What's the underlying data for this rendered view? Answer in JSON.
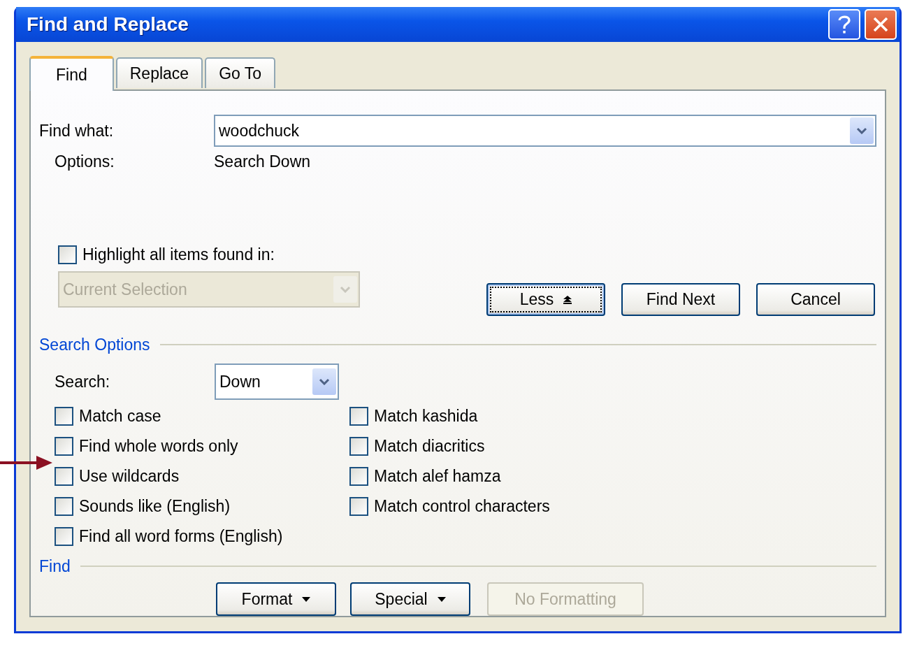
{
  "window": {
    "title": "Find and Replace"
  },
  "tabs": [
    {
      "label": "Find",
      "selected": true
    },
    {
      "label": "Replace",
      "selected": false
    },
    {
      "label": "Go To",
      "selected": false
    }
  ],
  "find_what": {
    "label": "Find what:",
    "value": "woodchuck"
  },
  "options": {
    "label": "Options:",
    "value": "Search Down"
  },
  "highlight": {
    "label": "Highlight all items found in:",
    "checked": false
  },
  "highlight_scope": {
    "value": "Current Selection",
    "disabled": true
  },
  "buttons": [
    {
      "label": "Less",
      "kind": "collapse",
      "focused": true
    },
    {
      "label": "Find Next",
      "kind": "plain",
      "focused": false
    },
    {
      "label": "Cancel",
      "kind": "plain",
      "focused": false
    }
  ],
  "search_options": {
    "title": "Search Options",
    "search_label": "Search:",
    "search_value": "Down",
    "left": [
      {
        "label": "Match case",
        "checked": false
      },
      {
        "label": "Find whole words only",
        "checked": false
      },
      {
        "label": "Use wildcards",
        "checked": false
      },
      {
        "label": "Sounds like (English)",
        "checked": false
      },
      {
        "label": "Find all word forms (English)",
        "checked": false
      }
    ],
    "right": [
      {
        "label": "Match kashida",
        "checked": false
      },
      {
        "label": "Match diacritics",
        "checked": false
      },
      {
        "label": "Match alef hamza",
        "checked": false
      },
      {
        "label": "Match control characters",
        "checked": false
      }
    ]
  },
  "find_section": {
    "title": "Find",
    "buttons": [
      {
        "label": "Format",
        "menu": true,
        "disabled": false
      },
      {
        "label": "Special",
        "menu": true,
        "disabled": false
      },
      {
        "label": "No Formatting",
        "menu": false,
        "disabled": true
      }
    ]
  }
}
